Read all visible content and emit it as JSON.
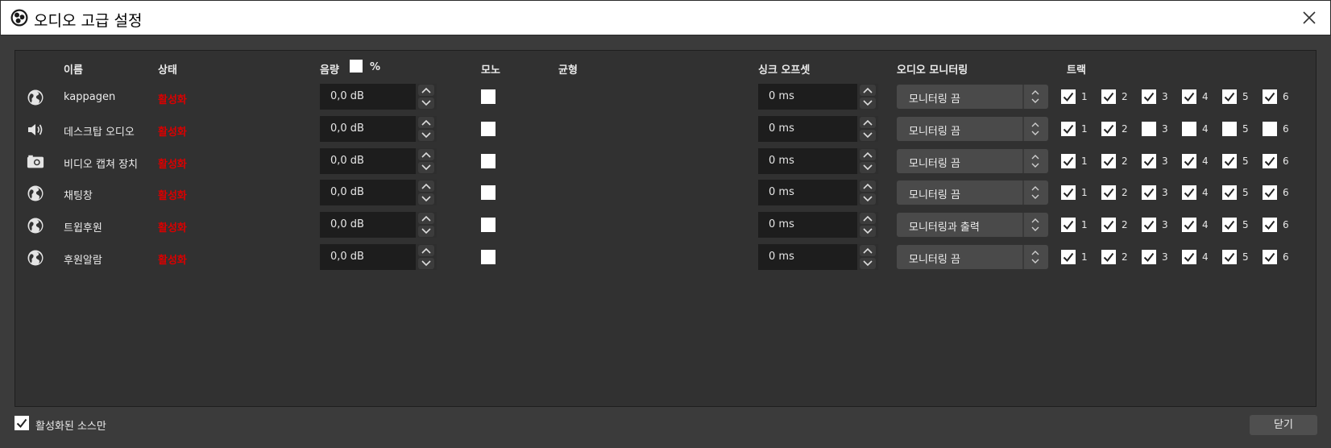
{
  "window": {
    "title": "오디오 고급 설정"
  },
  "headers": {
    "name": "이름",
    "status": "상태",
    "volume": "음량",
    "volume_unit": "%",
    "mono": "모노",
    "balance": "균형",
    "sync_offset": "싱크 오프셋",
    "monitoring": "오디오 모니터링",
    "tracks": "트랙"
  },
  "rows": [
    {
      "icon": "globe-icon",
      "name": "kappagen",
      "status": "활성화",
      "volume": "0,0 dB",
      "sync": "0 ms",
      "monitoring": "모니터링 끔",
      "tracks": [
        true,
        true,
        true,
        true,
        true,
        true
      ]
    },
    {
      "icon": "speaker-icon",
      "name": "데스크탑 오디오",
      "status": "활성화",
      "volume": "0,0 dB",
      "sync": "0 ms",
      "monitoring": "모니터링 끔",
      "tracks": [
        true,
        true,
        false,
        false,
        false,
        false
      ]
    },
    {
      "icon": "camera-icon",
      "name": "비디오 캡쳐 장치",
      "status": "활성화",
      "volume": "0,0 dB",
      "sync": "0 ms",
      "monitoring": "모니터링 끔",
      "tracks": [
        true,
        true,
        true,
        true,
        true,
        true
      ]
    },
    {
      "icon": "globe-icon",
      "name": "채팅창",
      "status": "활성화",
      "volume": "0,0 dB",
      "sync": "0 ms",
      "monitoring": "모니터링 끔",
      "tracks": [
        true,
        true,
        true,
        true,
        true,
        true
      ]
    },
    {
      "icon": "globe-icon",
      "name": "트윕후원",
      "status": "활성화",
      "volume": "0,0 dB",
      "sync": "0 ms",
      "monitoring": "모니터링과 출력",
      "tracks": [
        true,
        true,
        true,
        true,
        true,
        true
      ]
    },
    {
      "icon": "globe-icon",
      "name": "후원알람",
      "status": "활성화",
      "volume": "0,0 dB",
      "sync": "0 ms",
      "monitoring": "모니터링 끔",
      "tracks": [
        true,
        true,
        true,
        true,
        true,
        true
      ]
    }
  ],
  "track_labels": [
    "1",
    "2",
    "3",
    "4",
    "5",
    "6"
  ],
  "footer": {
    "active_only_label": "활성화된 소스만",
    "active_only_checked": true,
    "close_label": "닫기"
  },
  "colors": {
    "status_active": "#d90000",
    "panel_bg": "#313131",
    "dialog_bg": "#3b3b3b"
  }
}
